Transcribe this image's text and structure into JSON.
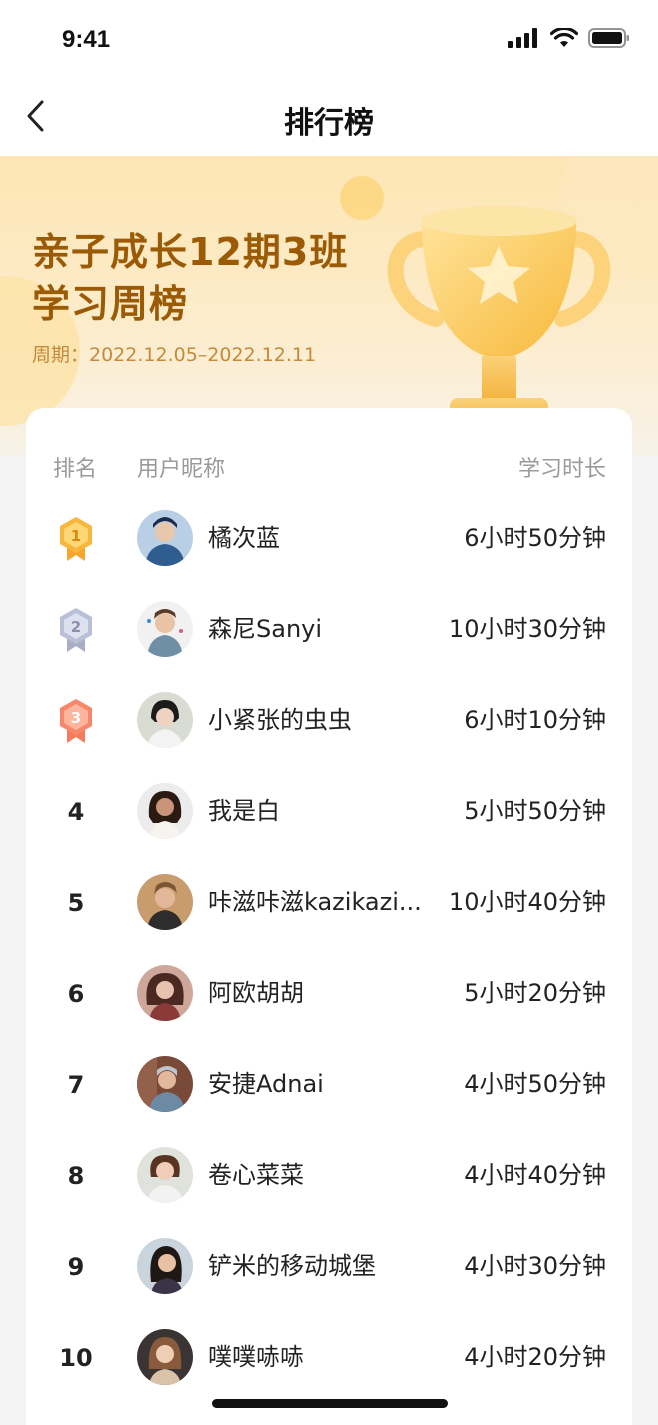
{
  "status_bar": {
    "time": "9:41"
  },
  "nav": {
    "title": "排行榜",
    "back_icon": "chevron-left-icon"
  },
  "banner": {
    "title_line1": "亲子成长12期3班",
    "title_line2": "学习周榜",
    "period": "周期：2022.12.05–2022.12.11",
    "trophy_icon": "trophy-icon"
  },
  "table": {
    "headers": {
      "rank": "排名",
      "name": "用户昵称",
      "duration": "学习时长"
    },
    "rows": [
      {
        "rank": "1",
        "medal": "gold-medal-icon",
        "name": "橘次蓝",
        "duration": "6小时50分钟"
      },
      {
        "rank": "2",
        "medal": "silver-medal-icon",
        "name": "森尼Sanyi",
        "duration": "10小时30分钟"
      },
      {
        "rank": "3",
        "medal": "bronze-medal-icon",
        "name": "小紧张的虫虫",
        "duration": "6小时10分钟"
      },
      {
        "rank": "4",
        "name": "我是白",
        "duration": "5小时50分钟"
      },
      {
        "rank": "5",
        "name": "咔滋咔滋kazikazi...",
        "duration": "10小时40分钟"
      },
      {
        "rank": "6",
        "name": "阿欧胡胡",
        "duration": "5小时20分钟"
      },
      {
        "rank": "7",
        "name": "安捷Adnai",
        "duration": "4小时50分钟"
      },
      {
        "rank": "8",
        "name": "卷心菜菜",
        "duration": "4小时40分钟"
      },
      {
        "rank": "9",
        "name": "铲米的移动城堡",
        "duration": "4小时30分钟"
      },
      {
        "rank": "10",
        "name": "噗噗哧哧",
        "duration": "4小时20分钟"
      }
    ]
  },
  "colors": {
    "title_brown": "#9b5a05",
    "period_gold": "#c48a3a",
    "gold_medal": "#f6b73c",
    "silver_medal": "#b9bfd6",
    "bronze_medal": "#f6876a"
  }
}
